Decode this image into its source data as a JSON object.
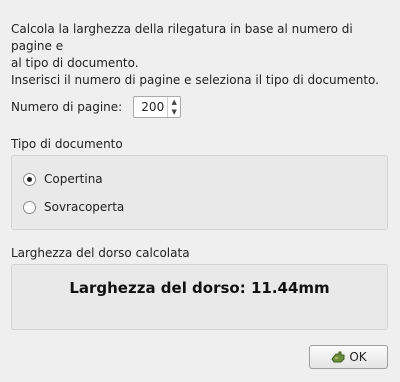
{
  "description": {
    "line1": "Calcola la larghezza della rilegatura in base al numero di pagine e",
    "line2": "al tipo di documento.",
    "line3": "Inserisci il numero di pagine e seleziona il tipo di documento."
  },
  "pages": {
    "label": "Numero di pagine:",
    "value": "200",
    "up_icon": "arrow-up",
    "down_icon": "arrow-down"
  },
  "doc_type": {
    "title": "Tipo di documento",
    "options": [
      {
        "label": "Copertina",
        "checked": true
      },
      {
        "label": "Sovracoperta",
        "checked": false
      }
    ]
  },
  "result": {
    "title": "Larghezza del dorso calcolata",
    "text": "Larghezza del dorso: 11.44mm"
  },
  "buttons": {
    "ok_label": "OK",
    "ok_icon": "ok-hand-icon"
  }
}
